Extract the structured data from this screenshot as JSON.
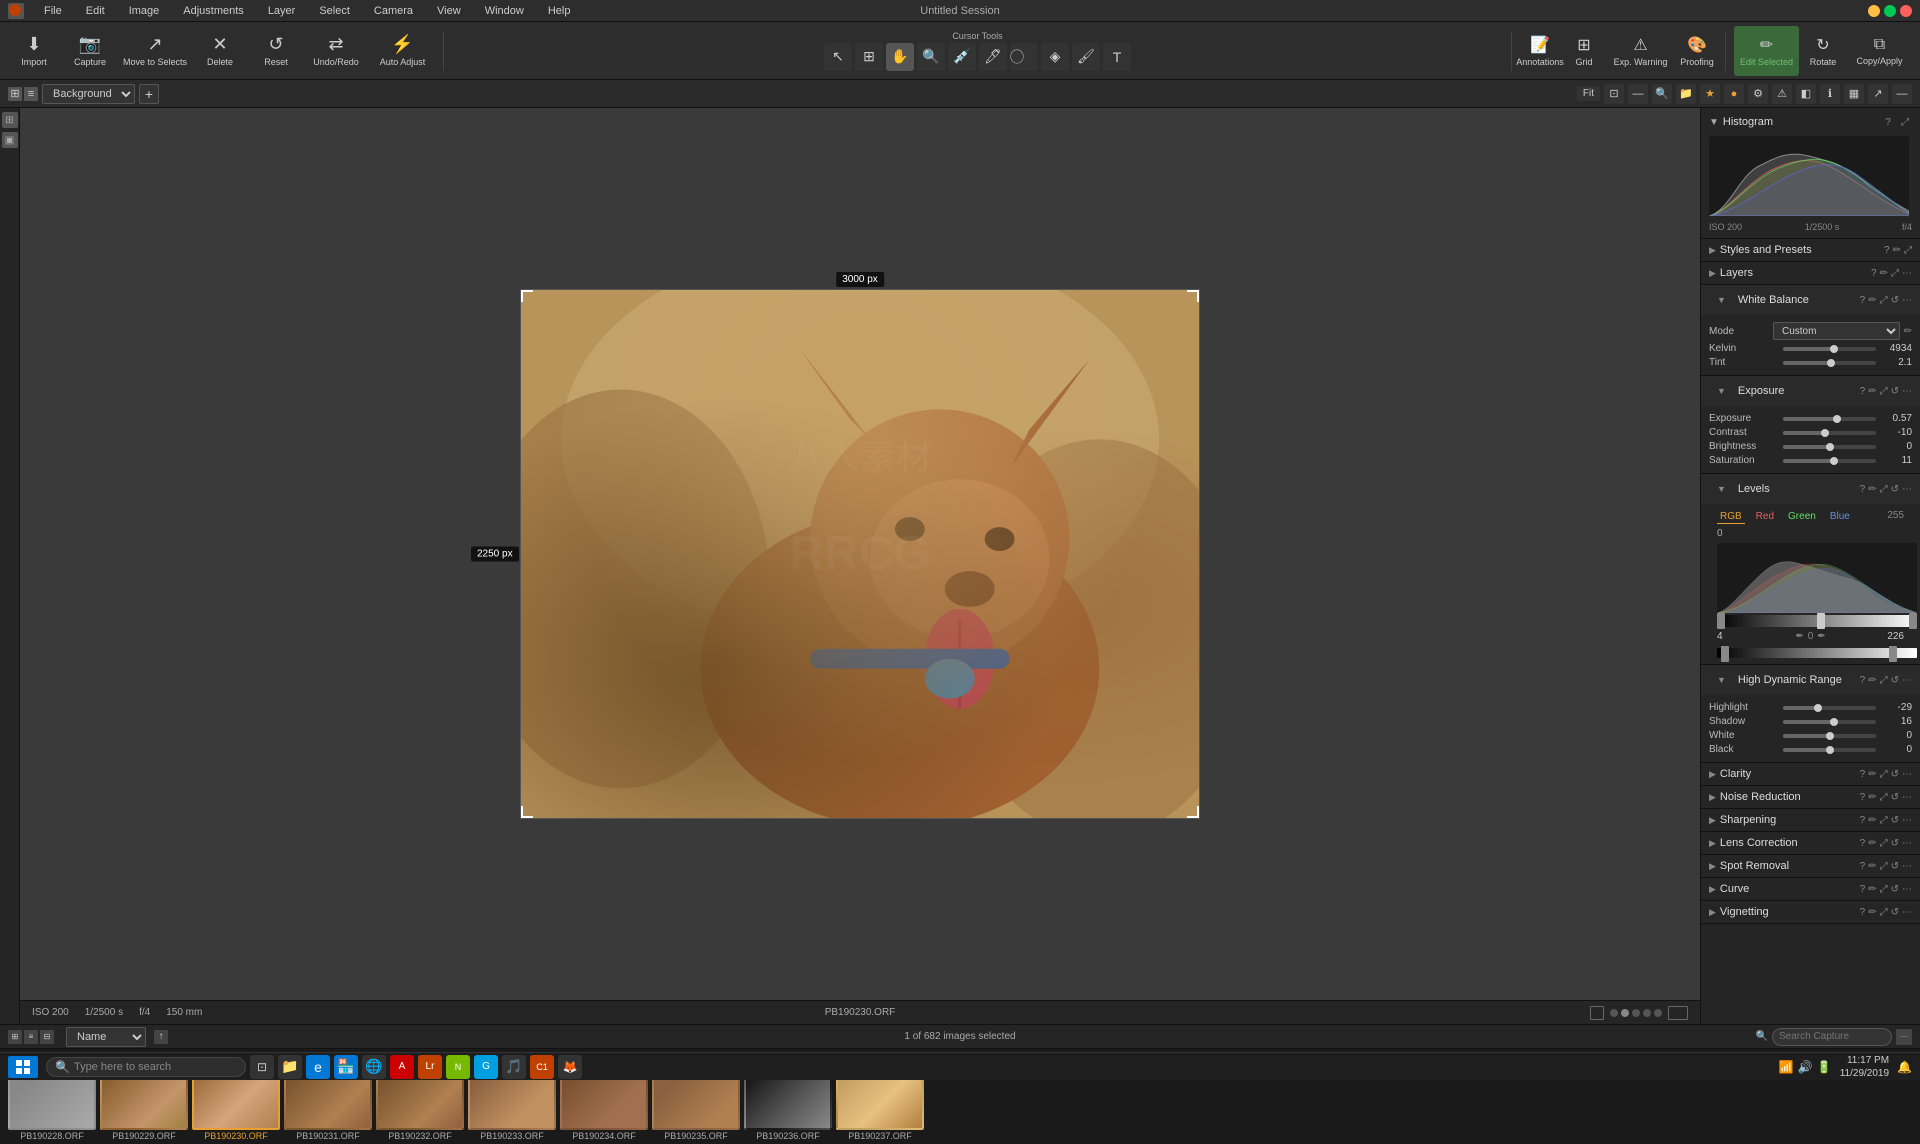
{
  "app": {
    "title": "Untitled Session",
    "window_controls": [
      "minimize",
      "maximize",
      "close"
    ]
  },
  "menu": {
    "items": [
      "File",
      "Edit",
      "Image",
      "Adjustments",
      "Layer",
      "Select",
      "Camera",
      "View",
      "Window",
      "Help"
    ]
  },
  "toolbar": {
    "import_label": "Import",
    "capture_label": "Capture",
    "move_to_selects_label": "Move to Selects",
    "delete_label": "Delete",
    "reset_label": "Reset",
    "undo_redo_label": "Undo/Redo",
    "auto_adjust_label": "Auto Adjust",
    "cursor_tools_label": "Cursor Tools",
    "annotations_label": "Annotations",
    "grid_label": "Grid",
    "exp_warning_label": "Exp. Warning",
    "proofing_label": "Proofing",
    "edit_selected_label": "Edit Selected",
    "rotate_label": "Rotate",
    "copy_apply_label": "Copy/Apply"
  },
  "canvas": {
    "dimension_top": "3000 px",
    "dimension_left": "2250 px",
    "filename": "PB190230.ORF",
    "iso": "ISO 200",
    "shutter": "1/2500 s",
    "aperture": "f/4",
    "focal_length": "150 mm"
  },
  "layers": {
    "current": "Background",
    "fit_label": "Fit"
  },
  "histogram": {
    "title": "Histogram",
    "iso_label": "ISO 200",
    "shutter_label": "1/2500 s",
    "aperture_label": "f/4"
  },
  "styles_presets": {
    "title": "Styles and Presets"
  },
  "layers_panel": {
    "title": "Layers"
  },
  "white_balance": {
    "title": "White Balance",
    "mode_label": "Mode",
    "mode_value": "Custom",
    "kelvin_label": "Kelvin",
    "kelvin_value": "4934",
    "tint_label": "Tint",
    "tint_value": "2.1",
    "kelvin_pct": 55,
    "tint_pct": 52
  },
  "exposure": {
    "title": "Exposure",
    "exposure_label": "Exposure",
    "exposure_value": "0.57",
    "exposure_pct": 58,
    "contrast_label": "Contrast",
    "contrast_value": "-10",
    "contrast_pct": 45,
    "brightness_label": "Brightness",
    "brightness_value": "0",
    "brightness_pct": 50,
    "saturation_label": "Saturation",
    "saturation_value": "11",
    "saturation_pct": 55
  },
  "levels": {
    "title": "Levels",
    "tabs": [
      "RGB",
      "Red",
      "Green",
      "Blue"
    ],
    "active_tab": "RGB",
    "min_val": "0",
    "max_val": "255",
    "output_min": "4",
    "output_max": "226",
    "black_point": "0",
    "white_point": "255"
  },
  "hdr": {
    "title": "High Dynamic Range",
    "highlight_label": "Highlight",
    "highlight_value": "-29",
    "highlight_pct": 38,
    "shadow_label": "Shadow",
    "shadow_value": "16",
    "shadow_pct": 55,
    "white_label": "White",
    "white_value": "0",
    "white_pct": 50,
    "black_label": "Black",
    "black_value": "0",
    "black_pct": 50
  },
  "clarity": {
    "title": "Clarity"
  },
  "noise_reduction": {
    "title": "Noise Reduction"
  },
  "sharpening": {
    "title": "Sharpening"
  },
  "lens_correction": {
    "title": "Lens Correction"
  },
  "spot_removal": {
    "title": "Spot Removal"
  },
  "curve": {
    "title": "Curve"
  },
  "vignetting": {
    "title": "Vignetting"
  },
  "filmstrip": {
    "sort_label": "Name",
    "count_label": "1 of 682 images selected",
    "search_placeholder": "Search Capture",
    "thumbnails": [
      {
        "filename": "PB190228.ORF",
        "class": "thumb-dog1"
      },
      {
        "filename": "PB190229.ORF",
        "class": "thumb-dog2"
      },
      {
        "filename": "PB190230.ORF",
        "class": "thumb-dog3",
        "selected": true
      },
      {
        "filename": "PB190231.ORF",
        "class": "thumb-dog4"
      },
      {
        "filename": "PB190232.ORF",
        "class": "thumb-dog5"
      },
      {
        "filename": "PB190233.ORF",
        "class": "thumb-dog6"
      },
      {
        "filename": "PB190234.ORF",
        "class": "thumb-dog7"
      },
      {
        "filename": "PB190235.ORF",
        "class": "thumb-dog8"
      },
      {
        "filename": "PB190236.ORF",
        "class": "thumb-dog9"
      },
      {
        "filename": "PB190237.ORF",
        "class": "thumb-dog11"
      }
    ]
  },
  "taskbar": {
    "search_placeholder": "Type here to search",
    "time": "11:17 PM",
    "date": "11/29/2019"
  }
}
